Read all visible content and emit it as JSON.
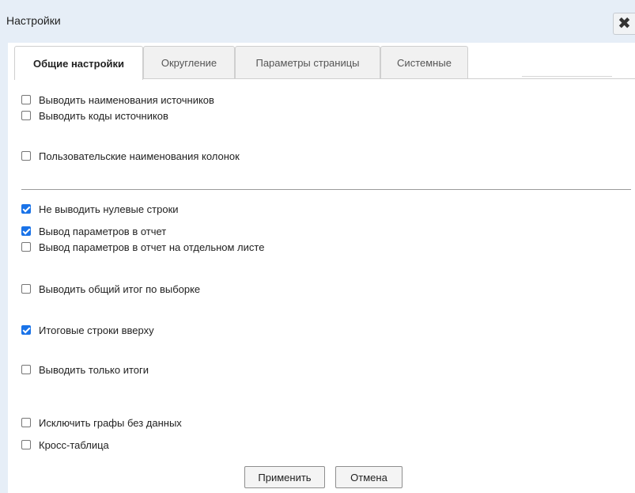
{
  "window": {
    "title": "Настройки"
  },
  "tabs": [
    {
      "label": "Общие настройки",
      "active": true
    },
    {
      "label": "Округление",
      "active": false
    },
    {
      "label": "Параметры страницы",
      "active": false
    },
    {
      "label": "Системные",
      "active": false
    }
  ],
  "options": [
    {
      "label": "Выводить наименования источников",
      "checked": false
    },
    {
      "label": "Выводить коды источников",
      "checked": false
    },
    {
      "label": "Пользовательские наименования колонок",
      "checked": false
    },
    {
      "label": "Не выводить нулевые строки",
      "checked": true
    },
    {
      "label": "Вывод параметров в отчет",
      "checked": true
    },
    {
      "label": "Вывод параметров в отчет на отдельном листе",
      "checked": false
    },
    {
      "label": "Выводить общий итог по выборке",
      "checked": false
    },
    {
      "label": "Итоговые строки вверху",
      "checked": true
    },
    {
      "label": "Выводить только итоги",
      "checked": false
    },
    {
      "label": "Исключить графы без данных",
      "checked": false
    },
    {
      "label": "Кросс-таблица",
      "checked": false
    }
  ],
  "buttons": {
    "apply": "Применить",
    "cancel": "Отмена"
  },
  "colors": {
    "accent": "#1a73e8",
    "titlebar": "#e6eef7"
  }
}
